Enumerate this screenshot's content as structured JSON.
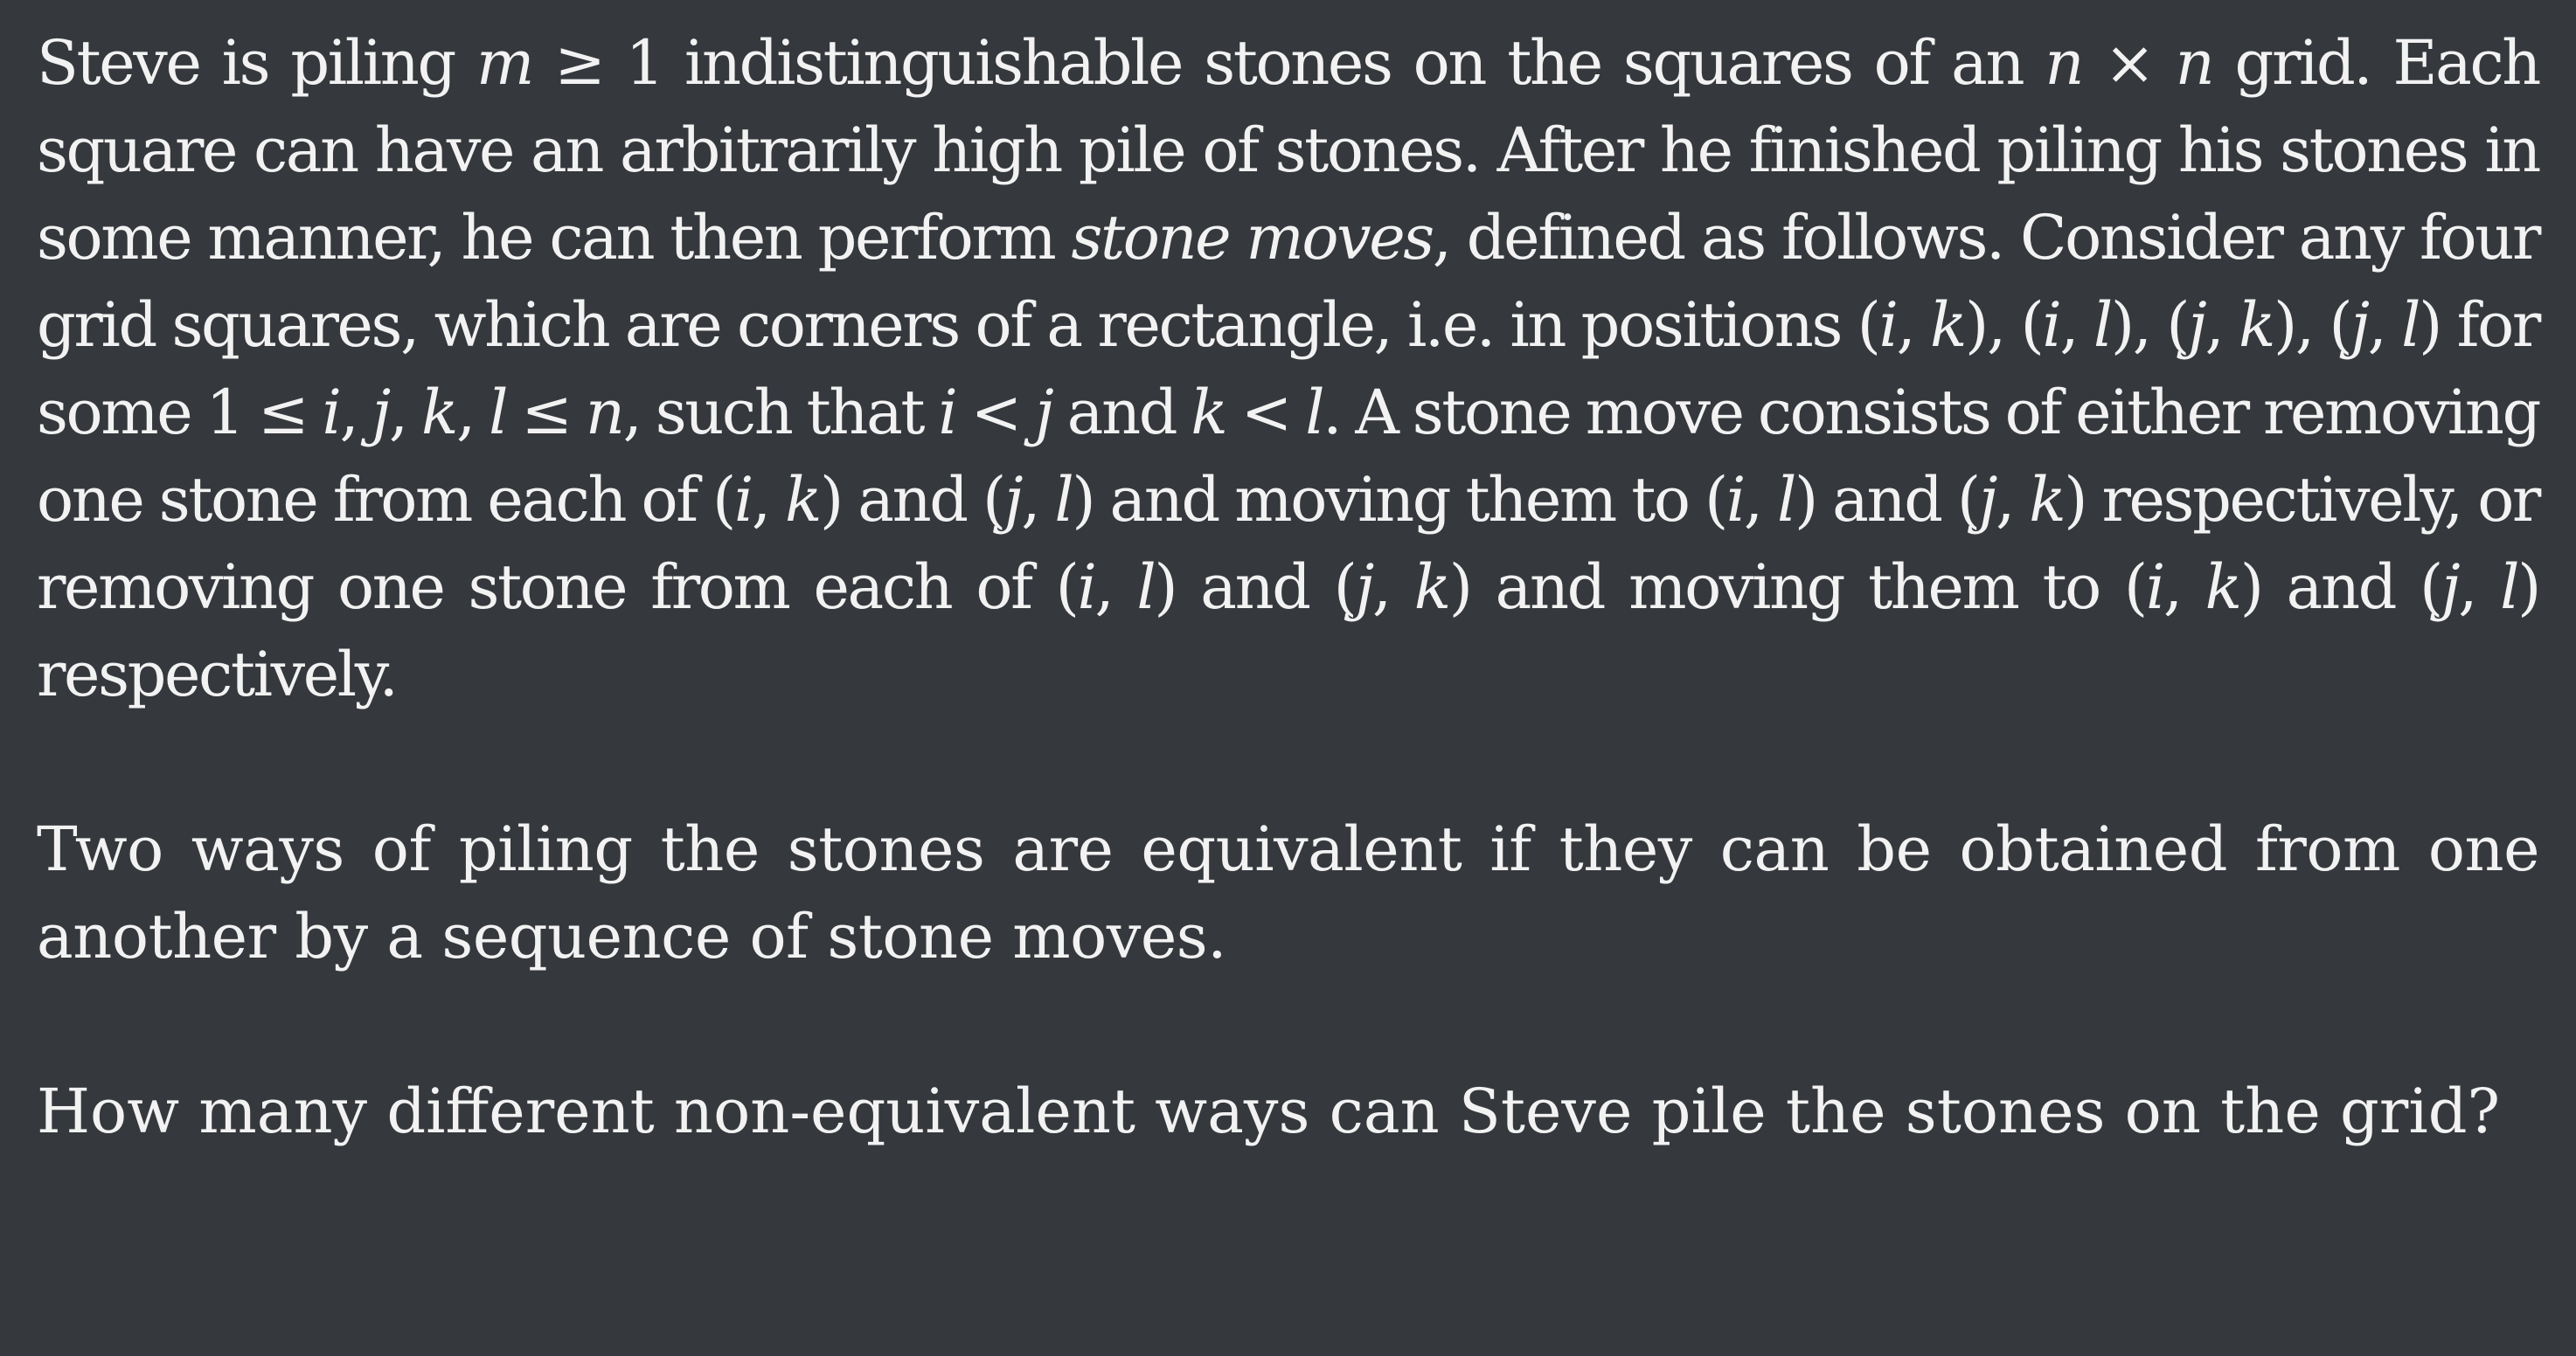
{
  "problem": {
    "paragraphs": [
      "Steve is piling 𝑚 ≥ 1 indistinguishable stones on the squares of an 𝑛 × 𝑛 grid. Each square can have an arbitrarily high pile of stones. After he finished piling his stones in some manner, he can then perform 𝑠𝑡𝑜𝑛𝑒 𝑚𝑜𝑣𝑒𝑠, defined as follows. Consider any four grid squares, which are corners of a rectangle, i.e. in positions (𝑖, 𝑘), (𝑖, 𝑙), (𝑗, 𝑘), (𝑗, 𝑙) for some 1 ≤ 𝑖, 𝑗, 𝑘, 𝑙 ≤ 𝑛, such that 𝑖 < 𝑗 and 𝑘 < 𝑙. A stone move consists of either removing one stone from each of (𝑖, 𝑘) and (𝑗, 𝑙) and moving them to (𝑖, 𝑙) and (𝑗, 𝑘) respectively, or removing one stone from each of (𝑖, 𝑙) and (𝑗, 𝑘) and moving them to (𝑖, 𝑘) and (𝑗, 𝑙) respectively.",
      "Two ways of piling the stones are equivalent if they can be obtained from one another by a sequence of stone moves.",
      "How many different non-equivalent ways can Steve pile the stones on the grid?"
    ]
  }
}
